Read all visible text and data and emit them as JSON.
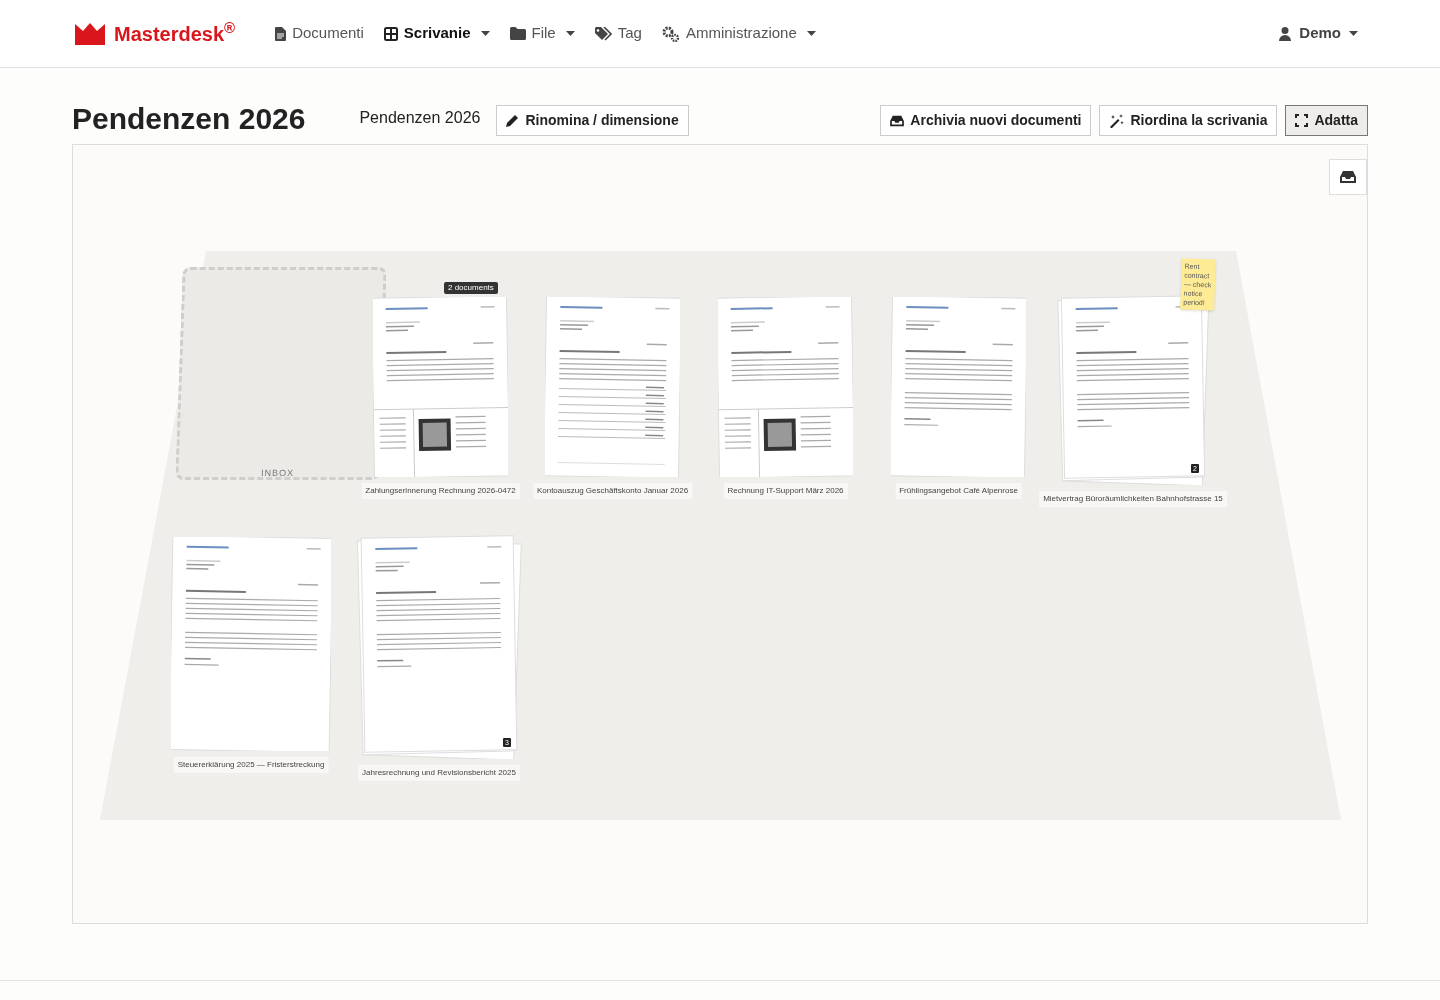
{
  "brand": {
    "name": "Masterdesk$^{®}$"
  },
  "nav": [
    {
      "label": "Documenti",
      "dropdown": false,
      "selected": false
    },
    {
      "label": "Scrivanie",
      "dropdown": true,
      "selected": true
    },
    {
      "label": "File",
      "dropdown": true,
      "selected": false
    },
    {
      "label": "Tag",
      "dropdown": false,
      "selected": false
    },
    {
      "label": "Amministrazione",
      "dropdown": true,
      "selected": false
    }
  ],
  "user": {
    "label": "Demo"
  },
  "page": {
    "title": "Pendenzen 2026",
    "desk_name": "Pendenzen 2026"
  },
  "toolbar": [
    {
      "label": "Rinomina / dimensione",
      "active": false
    },
    {
      "label": "Archivia nuovi documenti",
      "active": false
    },
    {
      "label": "Riordina la scrivania",
      "active": false
    },
    {
      "label": "Adatta",
      "active": true
    }
  ],
  "desk": {
    "inbox_label": "INBOX",
    "documents": [
      {
        "label": "Zahlungserinnerung Rechnung 2026-0472",
        "kind": "invoice",
        "tooltip": "2 documents"
      },
      {
        "label": "Kontoauszug Geschäftskonto Januar 2026",
        "kind": "statement"
      },
      {
        "label": "Rechnung IT-Support März 2026",
        "kind": "invoice"
      },
      {
        "label": "Frühlingsangebot Café Alpenrose",
        "kind": "letter"
      },
      {
        "label": "Mietvertrag Büroräumlichkeiten Bahnhofstrasse 15",
        "kind": "letter",
        "count": "2",
        "note": "Rent contract — check notice period!"
      },
      {
        "label": "Steuererklärung 2025 — Fristerstreckung",
        "kind": "letter"
      },
      {
        "label": "Jahresrechnung und Revisionsbericht 2025",
        "kind": "letter",
        "count": "3"
      }
    ]
  }
}
